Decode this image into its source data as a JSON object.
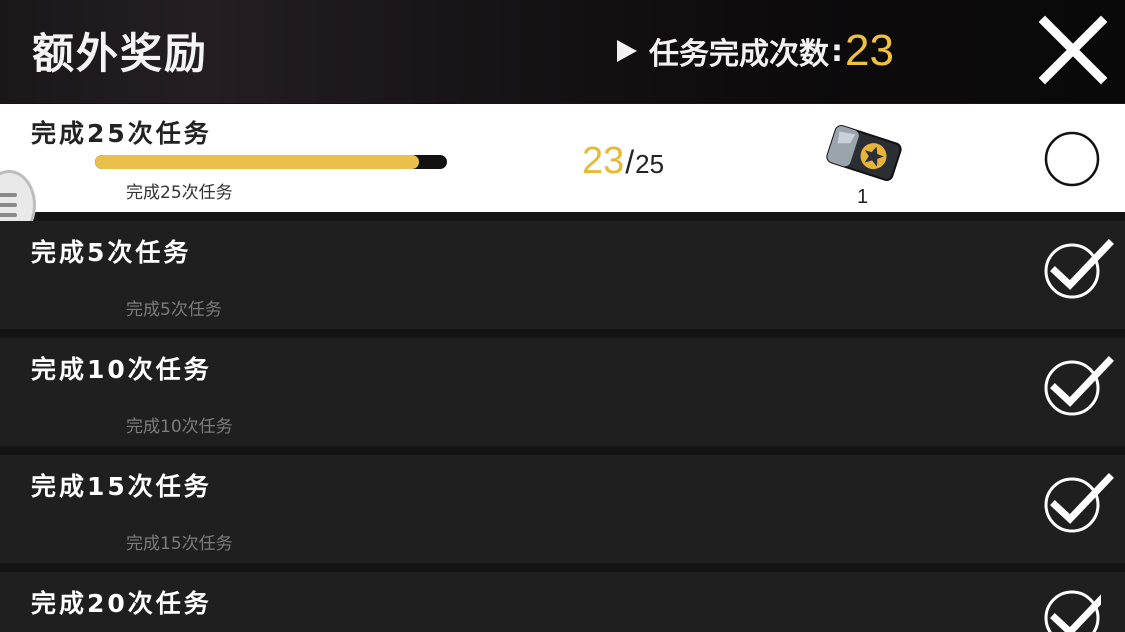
{
  "header": {
    "title": "额外奖励",
    "count_label": "任务完成次数",
    "count_colon": ":",
    "count_value": "23"
  },
  "tasks": [
    {
      "title": "完成25次任务",
      "subtitle": "完成25次任务",
      "progress_current": "23",
      "progress_separator": "/",
      "progress_total": "25",
      "progress_fraction": 0.92,
      "reward_icon": "ticket-star-icon",
      "reward_quantity": "1",
      "status": "incomplete"
    },
    {
      "title": "完成5次任务",
      "subtitle": "完成5次任务",
      "status": "completed"
    },
    {
      "title": "完成10次任务",
      "subtitle": "完成10次任务",
      "status": "completed"
    },
    {
      "title": "完成15次任务",
      "subtitle": "完成15次任务",
      "status": "completed"
    },
    {
      "title": "完成20次任务",
      "status": "completed"
    }
  ],
  "colors": {
    "accent_gold": "#e9c04a",
    "row_dark": "#1f1f1f",
    "row_active": "#ffffff"
  }
}
